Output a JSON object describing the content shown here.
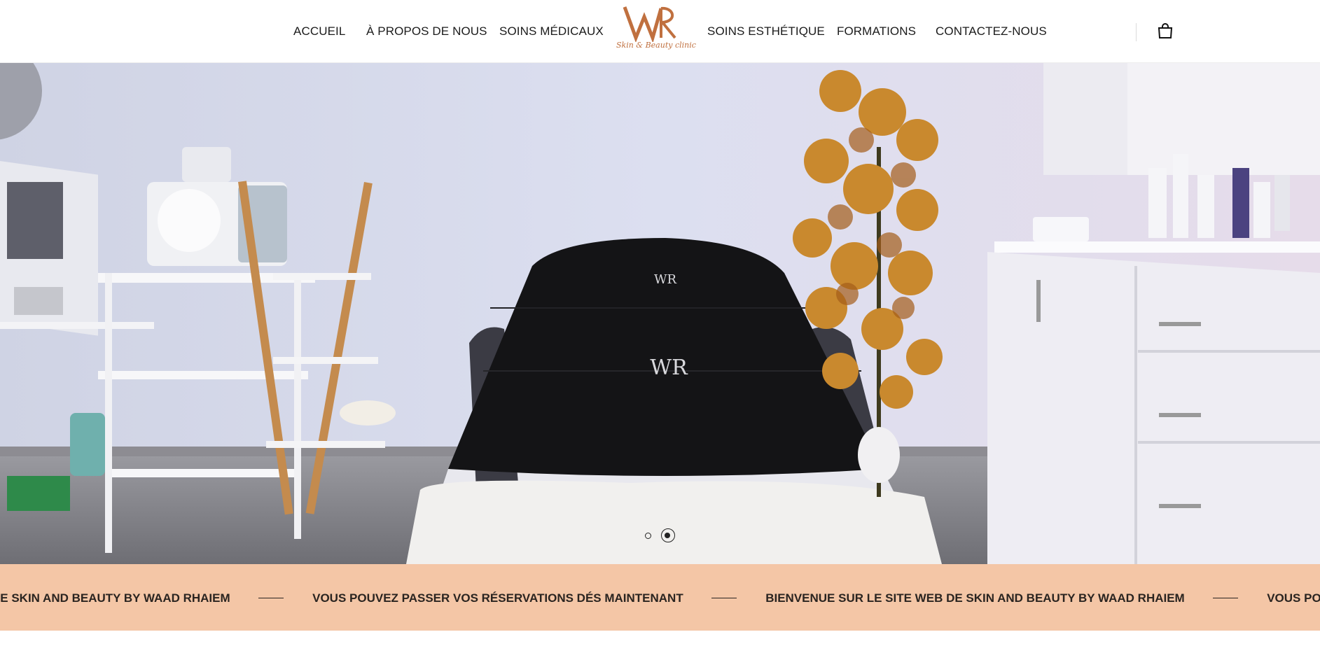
{
  "nav": {
    "left": [
      {
        "label": "ACCUEIL"
      },
      {
        "label": "À PROPOS DE NOUS"
      },
      {
        "label": "SOINS MÉDICAUX"
      }
    ],
    "right": [
      {
        "label": "SOINS ESTHÉTIQUE"
      },
      {
        "label": "FORMATIONS"
      },
      {
        "label": "CONTACTEZ-NOUS"
      }
    ]
  },
  "logo": {
    "monogram": "WR",
    "tagline": "Skin & Beauty clinic",
    "color": "#c0703f"
  },
  "header": {
    "cart_icon": "shopping-bag-icon"
  },
  "hero": {
    "slides_total": 2,
    "active_slide": 2,
    "towel_monogram": "WR"
  },
  "marquee": {
    "background": "#f4c6a6",
    "items": [
      "DE SKIN AND BEAUTY BY WAAD RHAIEM",
      "VOUS POUVEZ PASSER VOS RÉSERVATIONS DÉS MAINTENANT",
      "BIENVENUE SUR LE SITE WEB DE SKIN AND BEAUTY BY WAAD RHAIEM",
      "VOUS POUVEZ PASSER VOS RÉS"
    ]
  }
}
